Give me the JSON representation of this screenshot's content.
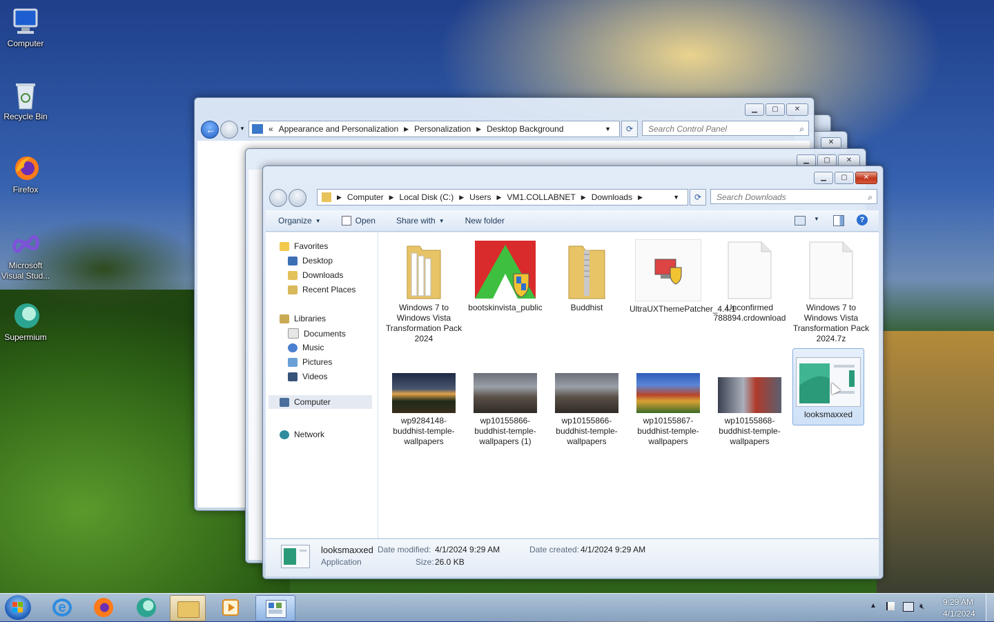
{
  "desktop": {
    "icons": [
      {
        "label": "Computer"
      },
      {
        "label": "Recycle Bin"
      },
      {
        "label": "Firefox"
      },
      {
        "label": "Microsoft Visual Stud..."
      },
      {
        "label": "Supermium"
      }
    ]
  },
  "control_panel": {
    "breadcrumb": [
      "Appearance and Personalization",
      "Personalization",
      "Desktop Background"
    ],
    "breadcrumb_prefix": "«",
    "search_placeholder": "Search Control Panel"
  },
  "explorer": {
    "breadcrumb": [
      "Computer",
      "Local Disk (C:)",
      "Users",
      "VM1.COLLABNET",
      "Downloads"
    ],
    "search_placeholder": "Search Downloads",
    "toolbar": {
      "organize": "Organize",
      "open": "Open",
      "share_with": "Share with",
      "new_folder": "New folder"
    },
    "nav": {
      "favorites": "Favorites",
      "desktop": "Desktop",
      "downloads": "Downloads",
      "recent_places": "Recent Places",
      "libraries": "Libraries",
      "documents": "Documents",
      "music": "Music",
      "pictures": "Pictures",
      "videos": "Videos",
      "computer": "Computer",
      "network": "Network"
    },
    "files": [
      {
        "name": "Windows 7 to Windows Vista Transformation Pack 2024",
        "kind": "folder"
      },
      {
        "name": "bootskinvista_public",
        "kind": "installer"
      },
      {
        "name": "Buddhist",
        "kind": "zip-folder"
      },
      {
        "name": "UltraUXThemePatcher_4.4.1",
        "kind": "installer"
      },
      {
        "name": "Unconfirmed 788894.crdownload",
        "kind": "blank"
      },
      {
        "name": "Windows 7 to Windows Vista Transformation Pack 2024.7z",
        "kind": "blank"
      },
      {
        "name": "wp9284148-buddhist-temple-wallpapers",
        "kind": "image"
      },
      {
        "name": "wp10155866-buddhist-temple-wallpapers (1)",
        "kind": "image"
      },
      {
        "name": "wp10155866-buddhist-temple-wallpapers",
        "kind": "image"
      },
      {
        "name": "wp10155867-buddhist-temple-wallpapers",
        "kind": "image"
      },
      {
        "name": "wp10155868-buddhist-temple-wallpapers",
        "kind": "image"
      },
      {
        "name": "looksmaxxed",
        "kind": "app"
      }
    ],
    "details": {
      "name": "looksmaxxed",
      "type": "Application",
      "date_modified_label": "Date modified:",
      "date_modified": "4/1/2024 9:29 AM",
      "date_created_label": "Date created:",
      "date_created": "4/1/2024 9:29 AM",
      "size_label": "Size:",
      "size": "26.0 KB"
    }
  },
  "taskbar": {
    "time": "9:29 AM",
    "date": "4/1/2024"
  }
}
